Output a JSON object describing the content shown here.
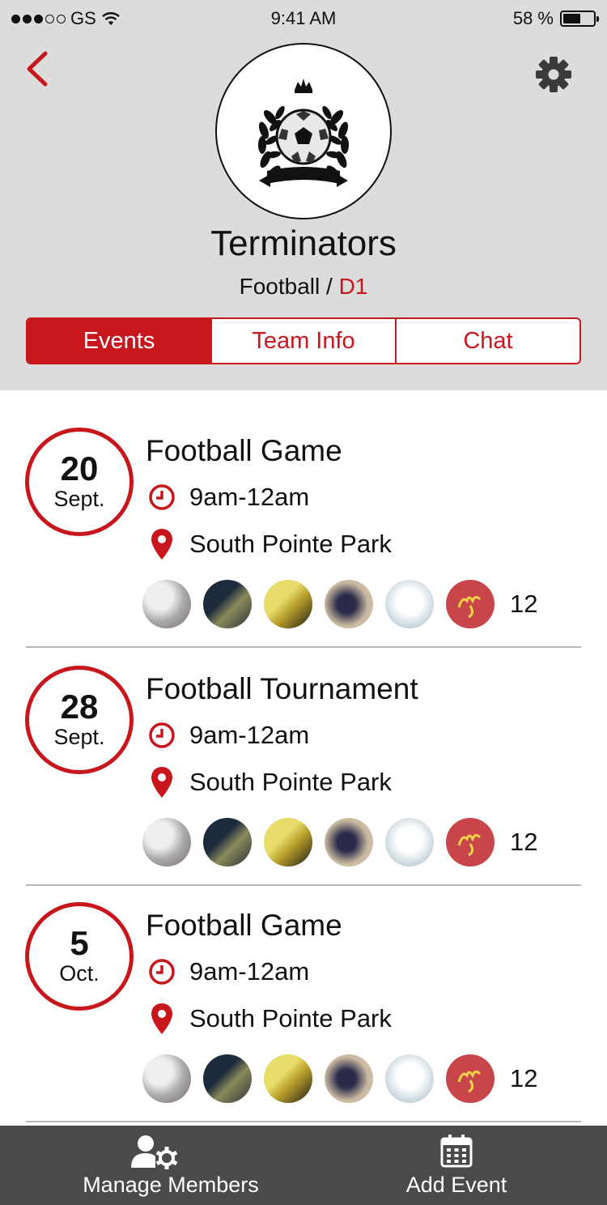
{
  "status_bar": {
    "carrier": "GS",
    "time": "9:41 AM",
    "battery": "58 %",
    "battery_level": 0.58
  },
  "team": {
    "name": "Terminators",
    "sport": "Football",
    "separator": " / ",
    "division": "D1"
  },
  "tabs": [
    {
      "label": "Events",
      "active": true
    },
    {
      "label": "Team Info",
      "active": false
    },
    {
      "label": "Chat",
      "active": false
    }
  ],
  "events": [
    {
      "day": "20",
      "month": "Sept.",
      "title": "Football Game",
      "time": "9am-12am",
      "location": "South Pointe Park",
      "attendees": "12"
    },
    {
      "day": "28",
      "month": "Sept.",
      "title": "Football Tournament",
      "time": "9am-12am",
      "location": "South Pointe Park",
      "attendees": "12"
    },
    {
      "day": "5",
      "month": "Oct.",
      "title": "Football Game",
      "time": "9am-12am",
      "location": "South Pointe Park",
      "attendees": "12"
    }
  ],
  "bottom_bar": {
    "manage_members": "Manage Members",
    "add_event": "Add Event"
  },
  "colors": {
    "accent": "#c8161d",
    "header_bg": "#dcdcdc",
    "bottom_bar_bg": "#4a4a4a"
  },
  "icons": {
    "back": "chevron-left-icon",
    "settings": "gear-icon",
    "time": "clock-icon",
    "location": "map-pin-icon",
    "manage_members": "user-gear-icon",
    "add_event": "calendar-icon"
  }
}
